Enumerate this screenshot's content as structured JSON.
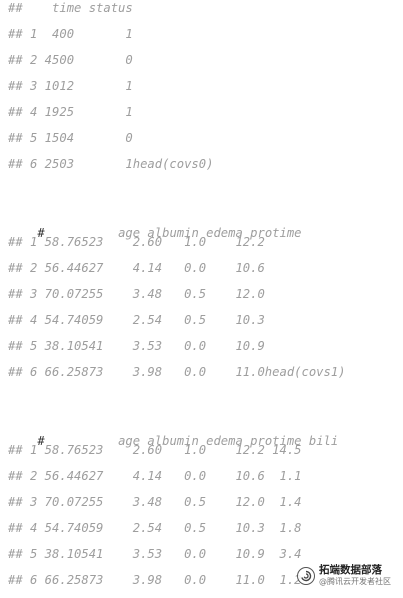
{
  "blocks": [
    {
      "lines": [
        "##    time status",
        "## 1  400       1",
        "## 2 4500       0",
        "## 3 1012       1",
        "## 4 1925       1",
        "## 5 1504       0",
        "## 6 2503       1head(covs0)"
      ]
    },
    {
      "lines": [
        "#          age albumin edema protime",
        "## 1 58.76523    2.60   1.0    12.2",
        "## 2 56.44627    4.14   0.0    10.6",
        "## 3 70.07255    3.48   0.5    12.0",
        "## 4 54.74059    2.54   0.5    10.3",
        "## 5 38.10541    3.53   0.0    10.9",
        "## 6 66.25873    3.98   0.0    11.0head(covs1)"
      ]
    },
    {
      "lines": [
        "#          age albumin edema protime bili",
        "## 1 58.76523    2.60   1.0    12.2 14.5",
        "## 2 56.44627    4.14   0.0    10.6  1.1",
        "## 3 70.07255    3.48   0.5    12.0  1.4",
        "## 4 54.74059    2.54   0.5    10.3  1.8",
        "## 5 38.10541    3.53   0.0    10.9  3.4",
        "## 6 66.25873    3.98   0.0    11.0  1.2"
      ]
    }
  ],
  "watermark": {
    "main": "拓端数据部落",
    "sub": "@腾讯云开发者社区",
    "icon": "swirl-logo-icon"
  },
  "colors": {
    "text": "#9e9e9e",
    "hash_dark": "#333333",
    "background": "#ffffff"
  }
}
